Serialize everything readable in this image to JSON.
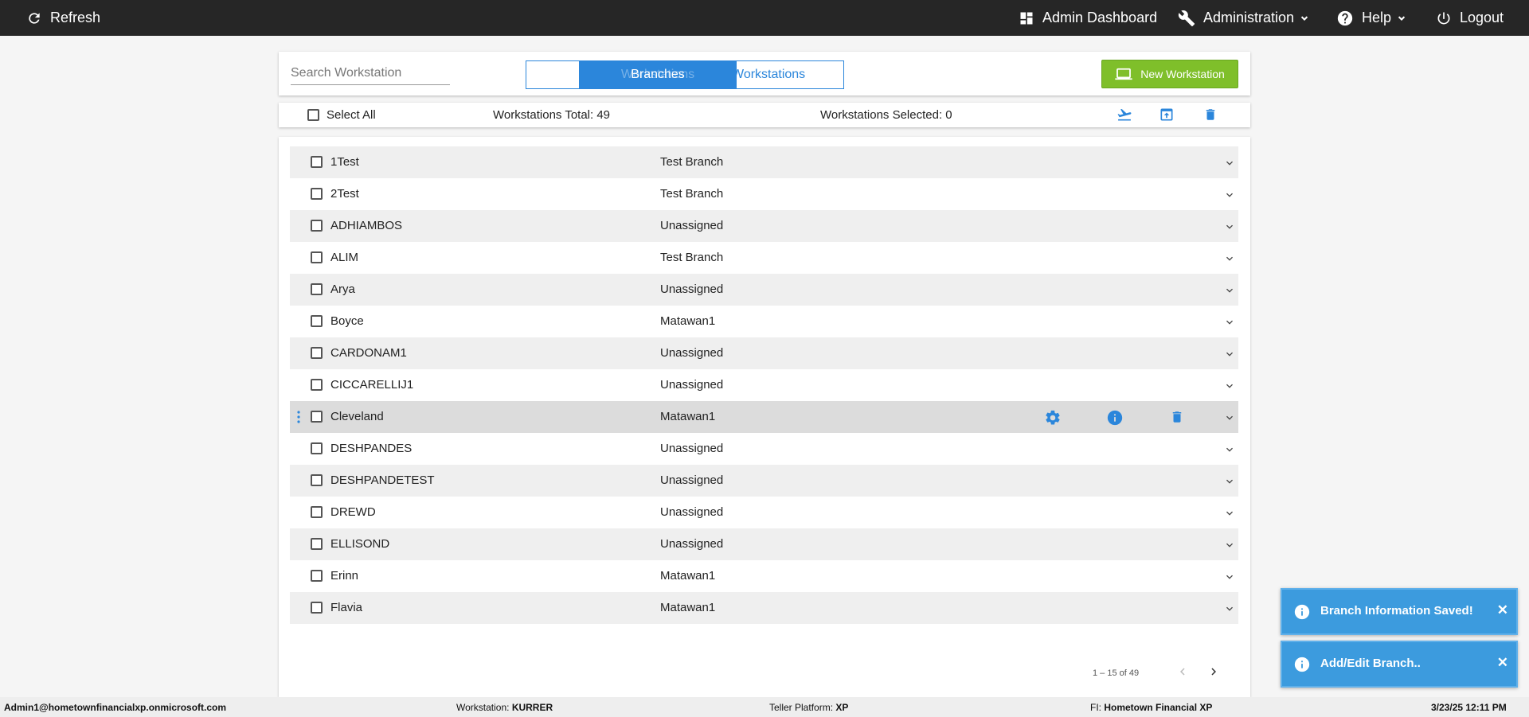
{
  "topbar": {
    "refresh": "Refresh",
    "admin_dashboard": "Admin Dashboard",
    "administration": "Administration",
    "help": "Help",
    "logout": "Logout"
  },
  "toolbar": {
    "search_placeholder": "Search Workstation",
    "toggle_active": "Branches",
    "toggle_ghost": "Workstations",
    "toggle_right": "Workstations",
    "new_button": "New Workstation"
  },
  "selection": {
    "select_all": "Select All",
    "total_label": "Workstations Total: 49",
    "selected_label": "Workstations Selected: 0"
  },
  "rows": [
    {
      "name": "1Test",
      "branch": "Test Branch"
    },
    {
      "name": "2Test",
      "branch": "Test Branch"
    },
    {
      "name": "ADHIAMBOS",
      "branch": "Unassigned"
    },
    {
      "name": "ALIM",
      "branch": "Test Branch"
    },
    {
      "name": "Arya",
      "branch": "Unassigned"
    },
    {
      "name": "Boyce",
      "branch": "Matawan1"
    },
    {
      "name": "CARDONAM1",
      "branch": "Unassigned"
    },
    {
      "name": "CICCARELLIJ1",
      "branch": "Unassigned"
    },
    {
      "name": "Cleveland",
      "branch": "Matawan1"
    },
    {
      "name": "DESHPANDES",
      "branch": "Unassigned"
    },
    {
      "name": "DESHPANDETEST",
      "branch": "Unassigned"
    },
    {
      "name": "DREWD",
      "branch": "Unassigned"
    },
    {
      "name": "ELLISOND",
      "branch": "Unassigned"
    },
    {
      "name": "Erinn",
      "branch": "Matawan1"
    },
    {
      "name": "Flavia",
      "branch": "Matawan1"
    }
  ],
  "pagination": {
    "range": "1 – 15 of 49"
  },
  "toasts": [
    {
      "text": "Branch Information Saved!"
    },
    {
      "text": "Add/Edit Branch.."
    }
  ],
  "footer": {
    "user": "Admin1@hometownfinancialxp.onmicrosoft.com",
    "workstation_label": "Workstation:",
    "workstation_value": "KURRER",
    "platform_label": "Teller Platform:",
    "platform_value": "XP",
    "fi_label": "FI:",
    "fi_value": "Hometown Financial XP",
    "datetime": "3/23/25 12:11 PM"
  },
  "colors": {
    "accent": "#2b86db",
    "topbar": "#262626",
    "new_button": "#7fbf2a",
    "toast": "#3c9bde"
  }
}
